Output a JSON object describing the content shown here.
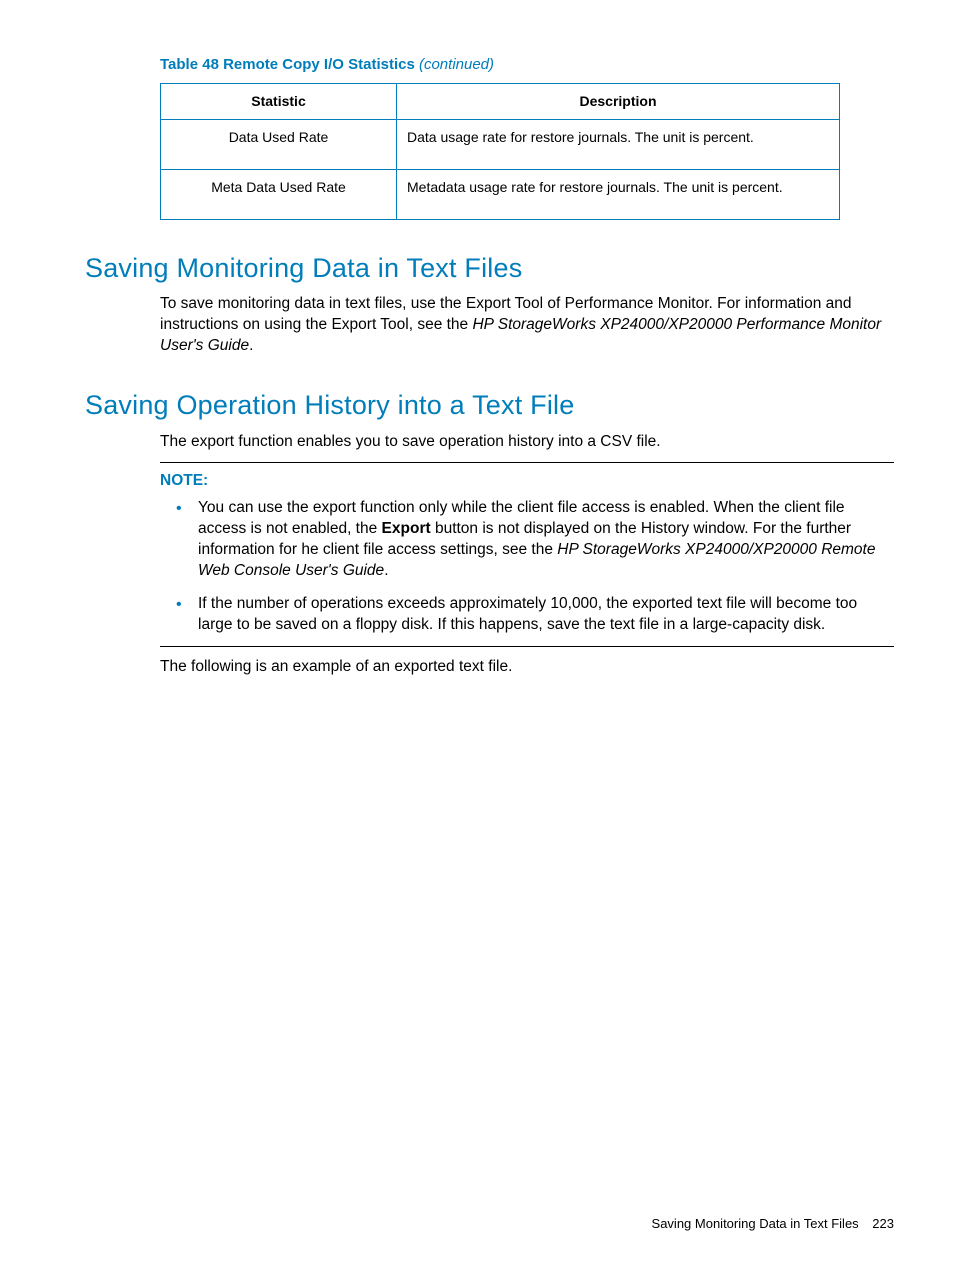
{
  "table": {
    "caption_main": "Table 48 Remote Copy I/O Statistics ",
    "caption_suffix": "(continued)",
    "headers": {
      "col1": "Statistic",
      "col2": "Description"
    },
    "rows": [
      {
        "stat": "Data Used Rate",
        "desc": "Data usage rate for restore journals. The unit is percent."
      },
      {
        "stat": "Meta Data Used Rate",
        "desc": "Metadata usage rate for restore journals. The unit is percent."
      }
    ]
  },
  "section1": {
    "heading": "Saving Monitoring Data in Text Files",
    "para_pre": "To save monitoring data in text files, use the Export Tool of Performance Monitor. For information and instructions on using the Export Tool, see the ",
    "para_em": "HP StorageWorks XP24000/XP20000 Performance Monitor User's Guide",
    "para_post": "."
  },
  "section2": {
    "heading": "Saving Operation History into a Text File",
    "intro": "The export function enables you to save operation history into a CSV file.",
    "note_label": "NOTE:",
    "bullets": {
      "b1_pre": "You can use the export function only while the client file access is enabled. When the client file access is not enabled, the ",
      "b1_bold": "Export",
      "b1_mid": " button is not displayed on the History window. For the further information for he client file access settings, see the ",
      "b1_em": "HP StorageWorks XP24000/XP20000 Remote Web Console User's Guide",
      "b1_post": ".",
      "b2": "If the number of operations exceeds approximately 10,000, the exported text file will become too large to be saved on a floppy disk. If this happens, save the text file in a large-capacity disk."
    },
    "after_note": "The following is an example of an exported text file."
  },
  "footer": {
    "text": "Saving Monitoring Data in Text Files",
    "page": "223"
  }
}
